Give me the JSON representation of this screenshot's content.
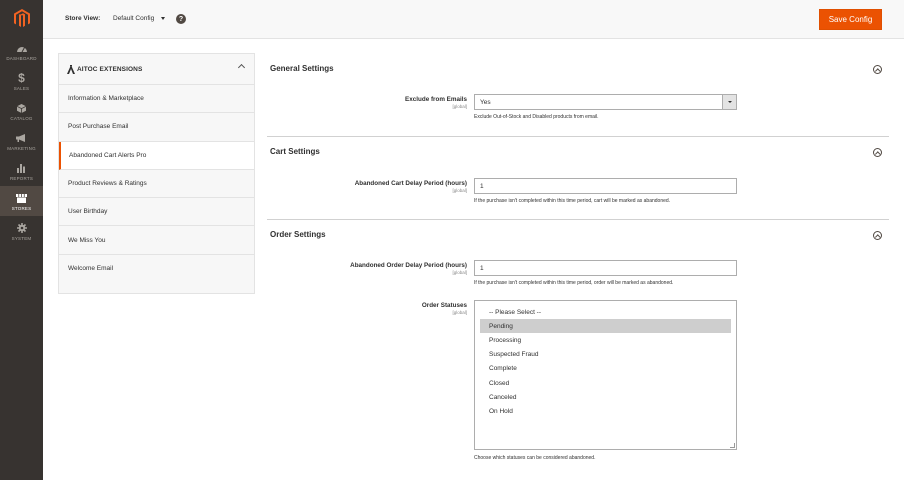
{
  "nav": {
    "items": [
      {
        "label": "DASHBOARD",
        "icon": "dashboard-icon"
      },
      {
        "label": "SALES",
        "icon": "dollar-icon"
      },
      {
        "label": "CATALOG",
        "icon": "cube-icon"
      },
      {
        "label": "MARKETING",
        "icon": "megaphone-icon"
      },
      {
        "label": "REPORTS",
        "icon": "bar-chart-icon"
      },
      {
        "label": "STORES",
        "icon": "store-icon"
      },
      {
        "label": "SYSTEM",
        "icon": "gear-icon"
      }
    ],
    "active": "STORES"
  },
  "header": {
    "store_view_label": "Store View:",
    "store_view_value": "Default Config",
    "help_glyph": "?",
    "save_label": "Save Config"
  },
  "tabs": {
    "group_title": "AITOC EXTENSIONS",
    "items": [
      {
        "label": "Information & Marketplace"
      },
      {
        "label": "Post Purchase Email"
      },
      {
        "label": "Abandoned Cart Alerts Pro"
      },
      {
        "label": "Product Reviews & Ratings"
      },
      {
        "label": "User Birthday"
      },
      {
        "label": "We Miss You"
      },
      {
        "label": "Welcome Email"
      }
    ],
    "active": "Abandoned Cart Alerts Pro"
  },
  "sections": {
    "general": {
      "title": "General Settings",
      "exclude_label": "Exclude from Emails",
      "exclude_scope": "[global]",
      "exclude_value": "Yes",
      "exclude_note": "Exclude Out-of-Stock and Disabled products from email."
    },
    "cart": {
      "title": "Cart Settings",
      "delay_label": "Abandoned Cart Delay Period (hours)",
      "delay_scope": "[global]",
      "delay_value": "1",
      "delay_note": "If the purchase isn't completed within this time period, cart will be marked as abandoned."
    },
    "order": {
      "title": "Order Settings",
      "delay_label": "Abandoned Order Delay Period (hours)",
      "delay_scope": "[global]",
      "delay_value": "1",
      "delay_note": "If the purchase isn't completed within this time period, order will be marked as abandoned.",
      "statuses_label": "Order Statuses",
      "statuses_scope": "[global]",
      "statuses_options": [
        "-- Please Select --",
        "Pending",
        "Processing",
        "Suspected Fraud",
        "Complete",
        "Closed",
        "Canceled",
        "On Hold"
      ],
      "statuses_selected": "Pending",
      "statuses_note": "Choose which statuses can be considered abandoned."
    }
  },
  "colors": {
    "accent": "#eb5202",
    "nav_bg": "#373330",
    "nav_active": "#514943"
  }
}
